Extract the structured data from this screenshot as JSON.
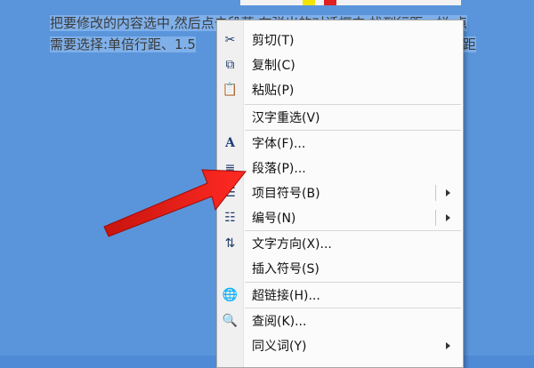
{
  "document": {
    "line1": "把要修改的内容选中,然后点击段落,在弹出的对话框中,找到行距一栏,点",
    "line2_left": "需要选择:单倍行距、1.5",
    "line2_right": "和多倍行距"
  },
  "menu": {
    "items": [
      {
        "label": "剪切(T)",
        "icon": "scissors-icon"
      },
      {
        "label": "复制(C)",
        "icon": "copy-icon"
      },
      {
        "label": "粘贴(P)",
        "icon": "paste-icon"
      },
      {
        "label": "汉字重选(V)",
        "icon": ""
      },
      {
        "label": "字体(F)...",
        "icon": "font-icon"
      },
      {
        "label": "段落(P)...",
        "icon": "paragraph-icon"
      },
      {
        "label": "项目符号(B)",
        "icon": "bullets-icon",
        "submenu": true
      },
      {
        "label": "编号(N)",
        "icon": "numbering-icon",
        "submenu": true
      },
      {
        "label": "文字方向(X)...",
        "icon": "text-direction-icon"
      },
      {
        "label": "插入符号(S)",
        "icon": ""
      },
      {
        "label": "超链接(H)...",
        "icon": "hyperlink-icon"
      },
      {
        "label": "查阅(K)...",
        "icon": "lookup-icon"
      },
      {
        "label": "同义词(Y)",
        "icon": "",
        "submenu": true
      }
    ]
  },
  "colors": {
    "background": "#5a95db",
    "selection": "#7fb0ea",
    "arrow": "#e8231c"
  }
}
